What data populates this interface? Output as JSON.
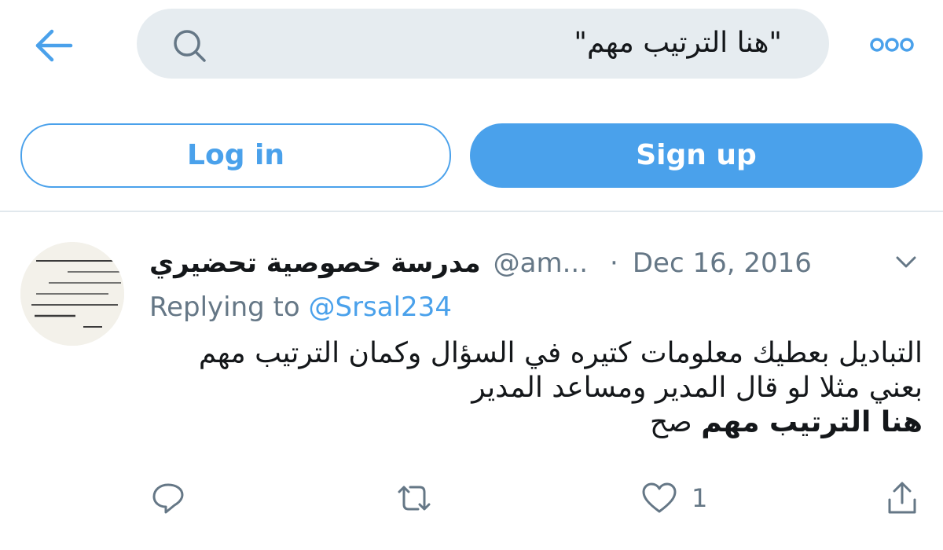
{
  "search": {
    "query": "\"هنا الترتيب مهم\""
  },
  "auth": {
    "login_label": "Log in",
    "signup_label": "Sign up"
  },
  "tweet": {
    "display_name": "مدرسة خصوصية تحضيري",
    "handle": "@am...",
    "separator": "·",
    "date": "Dec 16, 2016",
    "replying_label": "Replying to",
    "replying_to": "@Srsal234",
    "body_line1": "التباديل بعطيك معلومات كتيره في السؤال وكمان الترتيب مهم",
    "body_line2": "بعني مثلا لو قال المدير ومساعد المدير",
    "body_line3_bold": "هنا الترتيب مهم",
    "body_line3_rest": "صح",
    "like_count": "1"
  },
  "icons": {
    "back": "arrow-left-icon",
    "search": "search-icon",
    "more": "more-dots-icon",
    "caret": "chevron-down-icon",
    "reply": "reply-icon",
    "retweet": "retweet-icon",
    "like": "heart-icon",
    "share": "share-icon"
  },
  "colors": {
    "accent": "#4aa1eb",
    "secondary_text": "#657786",
    "search_bg": "#e6ecf0"
  }
}
